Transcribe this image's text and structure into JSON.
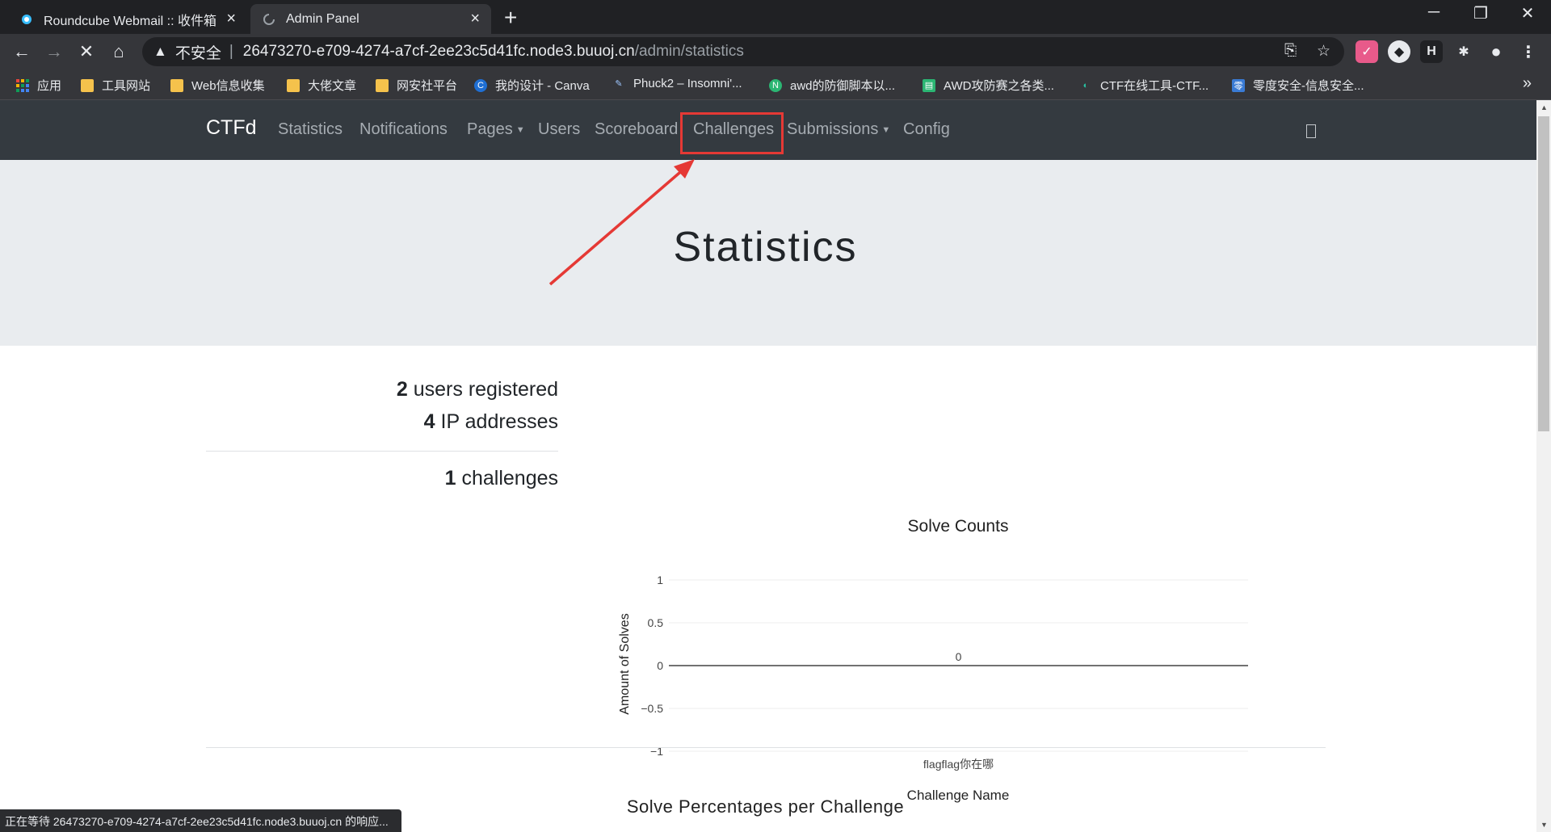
{
  "browser": {
    "tabs": [
      {
        "title": "Roundcube Webmail :: 收件箱",
        "active": false
      },
      {
        "title": "Admin Panel",
        "active": true
      }
    ],
    "url": {
      "security_label": "不安全",
      "host": "26473270-e709-4274-a7cf-2ee23c5d41fc.node3.buuoj.cn",
      "path": "/admin/statistics"
    },
    "bookmarks": [
      "应用",
      "工具网站",
      "Web信息收集",
      "大佬文章",
      "网安社平台",
      "我的设计 - Canva",
      "Phuck2 – Insomni'...",
      "awd的防御脚本以...",
      "AWD攻防赛之各类...",
      "CTF在线工具-CTF...",
      "零度安全-信息安全..."
    ],
    "status_text": "正在等待 26473270-e709-4274-a7cf-2ee23c5d41fc.node3.buuoj.cn 的响应..."
  },
  "navbar": {
    "brand": "CTFd",
    "items": [
      {
        "label": "Statistics",
        "dropdown": false
      },
      {
        "label": "Notifications",
        "dropdown": false
      },
      {
        "label": "Pages",
        "dropdown": true
      },
      {
        "label": "Users",
        "dropdown": false
      },
      {
        "label": "Scoreboard",
        "dropdown": false
      },
      {
        "label": "Challenges",
        "dropdown": false,
        "highlighted": true
      },
      {
        "label": "Submissions",
        "dropdown": true
      },
      {
        "label": "Config",
        "dropdown": false
      }
    ]
  },
  "page": {
    "title": "Statistics",
    "stats": {
      "users_count": "2",
      "users_label": "users registered",
      "ip_count": "4",
      "ip_label": "IP addresses",
      "challenges_count": "1",
      "challenges_label": "challenges"
    },
    "next_section_title": "Solve Percentages per Challenge"
  },
  "colors": {
    "navbar_bg": "#343a40",
    "jumbotron_bg": "#e9ecef",
    "annotation_red": "#e53935"
  },
  "chart_data": {
    "type": "bar",
    "title": "Solve Counts",
    "xlabel": "Challenge Name",
    "ylabel": "Amount of Solves",
    "categories": [
      "flagflag你在哪"
    ],
    "values": [
      0
    ],
    "data_labels": [
      "0"
    ],
    "ylim": [
      -1,
      1
    ],
    "yticks": [
      1,
      0.5,
      0,
      -0.5,
      -1
    ],
    "ytick_labels": [
      "1",
      "0.5",
      "0",
      "−0.5",
      "−1"
    ],
    "grid": true
  }
}
